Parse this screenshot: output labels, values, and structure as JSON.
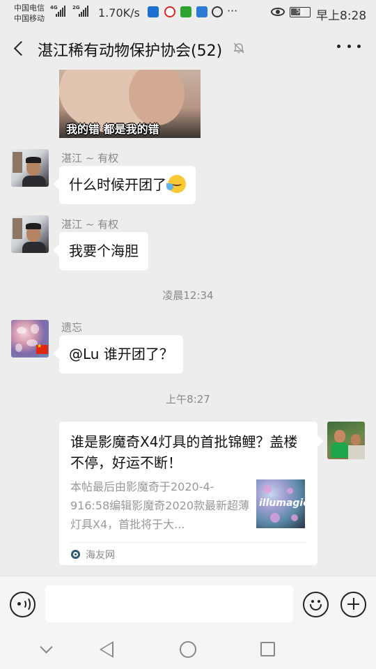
{
  "status_bar": {
    "carrier_1": "中国电信",
    "carrier_2": "中国移动",
    "net_1": "4G",
    "net_2": "2G",
    "speed": "1.70K/s",
    "battery": "51",
    "time": "早上8:28"
  },
  "header": {
    "title": "湛江稀有动物保护协会(52)",
    "back_icon": "back-arrow-icon",
    "mute_icon": "mute-bell-icon",
    "more_icon": "more-icon"
  },
  "messages": [
    {
      "type": "image",
      "caption": "我的错 都是我的错"
    },
    {
      "type": "text",
      "sender": "湛江 ~ 有权",
      "text": "什么时候开团了",
      "emoji": "crying-laughing-emoji"
    },
    {
      "type": "text",
      "sender": "湛江 ~ 有权",
      "text": "我要个海胆"
    },
    {
      "type": "time",
      "text": "凌晨12:34"
    },
    {
      "type": "text",
      "sender": "遗忘",
      "text": "@Lu  谁开团了？"
    },
    {
      "type": "time",
      "text": "上午8:27"
    },
    {
      "type": "link_card",
      "title": "谁是影魔奇X4灯具的首批锦鲤？盖楼不停，好运不断！",
      "description": "本帖最后由影魔奇于2020-4-916:58编辑影魔奇2020款最新超薄灯具X4，首批将于大...",
      "thumb_text": "illumagic",
      "source": "海友网"
    }
  ],
  "input_bar": {
    "voice_icon": "voice-icon",
    "placeholder": "",
    "emoji_icon": "emoji-icon",
    "plus_icon": "plus-icon"
  },
  "colors": {
    "background": "#ededed",
    "bubble": "#ffffff",
    "muted_text": "#888888"
  }
}
